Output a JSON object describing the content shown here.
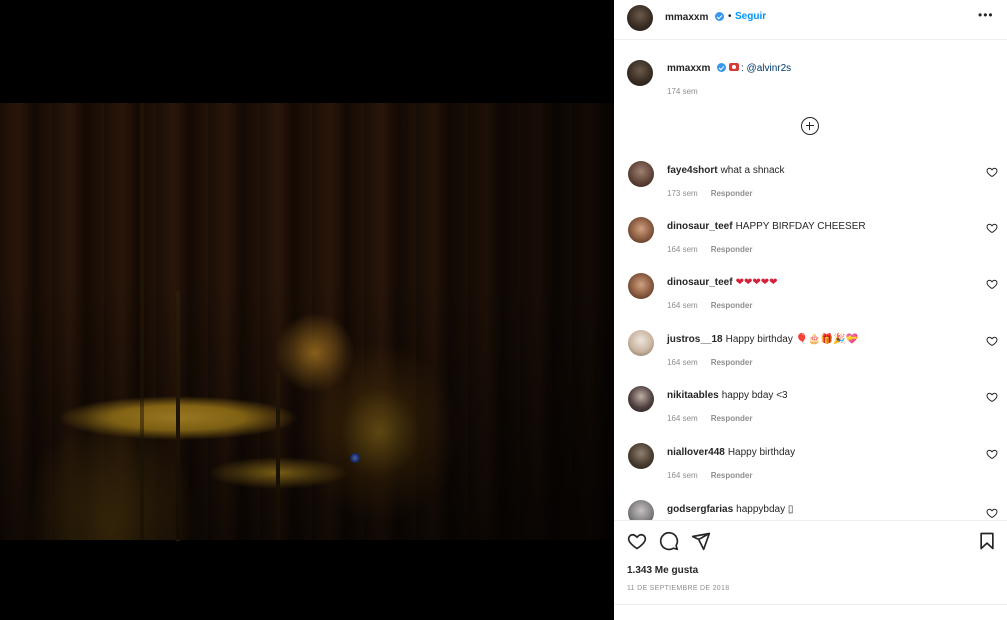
{
  "header": {
    "username": "mmaxxm",
    "separator": "•",
    "follow_label": "Seguir",
    "more_label": "•••"
  },
  "caption": {
    "username": "mmaxxm",
    "text": ": @alvinr2s",
    "time": "174 sem"
  },
  "comments": [
    {
      "username": "faye4short",
      "text": "what a shnack",
      "time": "173 sem",
      "reply_label": "Responder"
    },
    {
      "username": "dinosaur_teef",
      "text": "HAPPY BIRFDAY CHEESER",
      "time": "164 sem",
      "reply_label": "Responder"
    },
    {
      "username": "dinosaur_teef",
      "text": "❤❤❤❤❤",
      "time": "164 sem",
      "reply_label": "Responder"
    },
    {
      "username": "justros__18",
      "text": "Happy birthday 🎈🎂🎁🎉💝",
      "time": "164 sem",
      "reply_label": "Responder"
    },
    {
      "username": "nikitaables",
      "text": "happy bday <3",
      "time": "164 sem",
      "reply_label": "Responder"
    },
    {
      "username": "niallover448",
      "text": "Happy birthday",
      "time": "164 sem",
      "reply_label": "Responder"
    },
    {
      "username": "godsergfarias",
      "text": "happybday ▯",
      "time": "",
      "reply_label": ""
    }
  ],
  "footer": {
    "likes": "1.343 Me gusta",
    "date": "11 DE SEPTIEMBRE DE 2018"
  },
  "colors": {
    "accent": "#0095f6",
    "verified": "#3897f0",
    "text": "#262626",
    "muted": "#8e8e8e",
    "heart_emoji": "#d6203a"
  },
  "icons": [
    "verified-icon",
    "more-icon",
    "add-circle-icon",
    "heart-icon",
    "comment-icon",
    "share-icon",
    "bookmark-icon"
  ]
}
